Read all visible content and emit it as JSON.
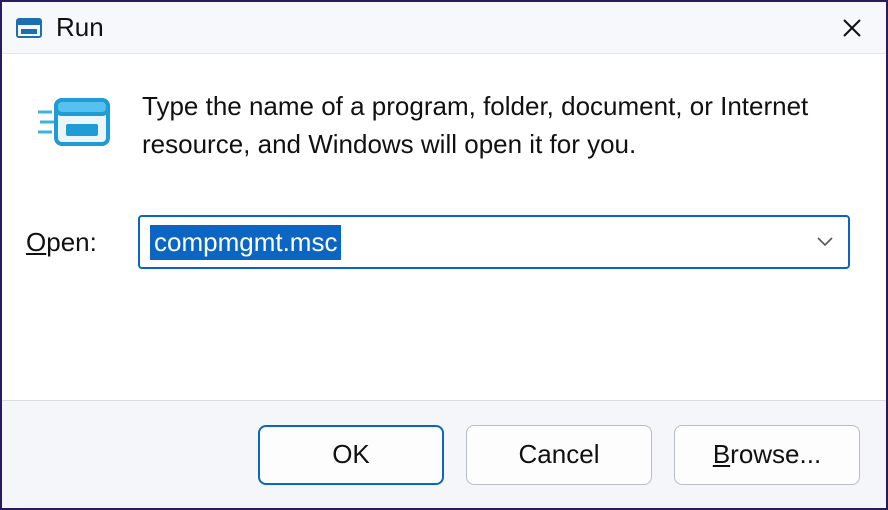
{
  "titlebar": {
    "title": "Run",
    "icon": "run-icon",
    "close_icon": "close-icon"
  },
  "content": {
    "description": "Type the name of a program, folder, document, or Internet resource, and Windows will open it for you.",
    "open_label_pre": "O",
    "open_label_post": "pen:",
    "input_value": "compmgmt.msc"
  },
  "buttons": {
    "ok": "OK",
    "cancel": "Cancel",
    "browse_pre": "B",
    "browse_post": "rowse..."
  }
}
